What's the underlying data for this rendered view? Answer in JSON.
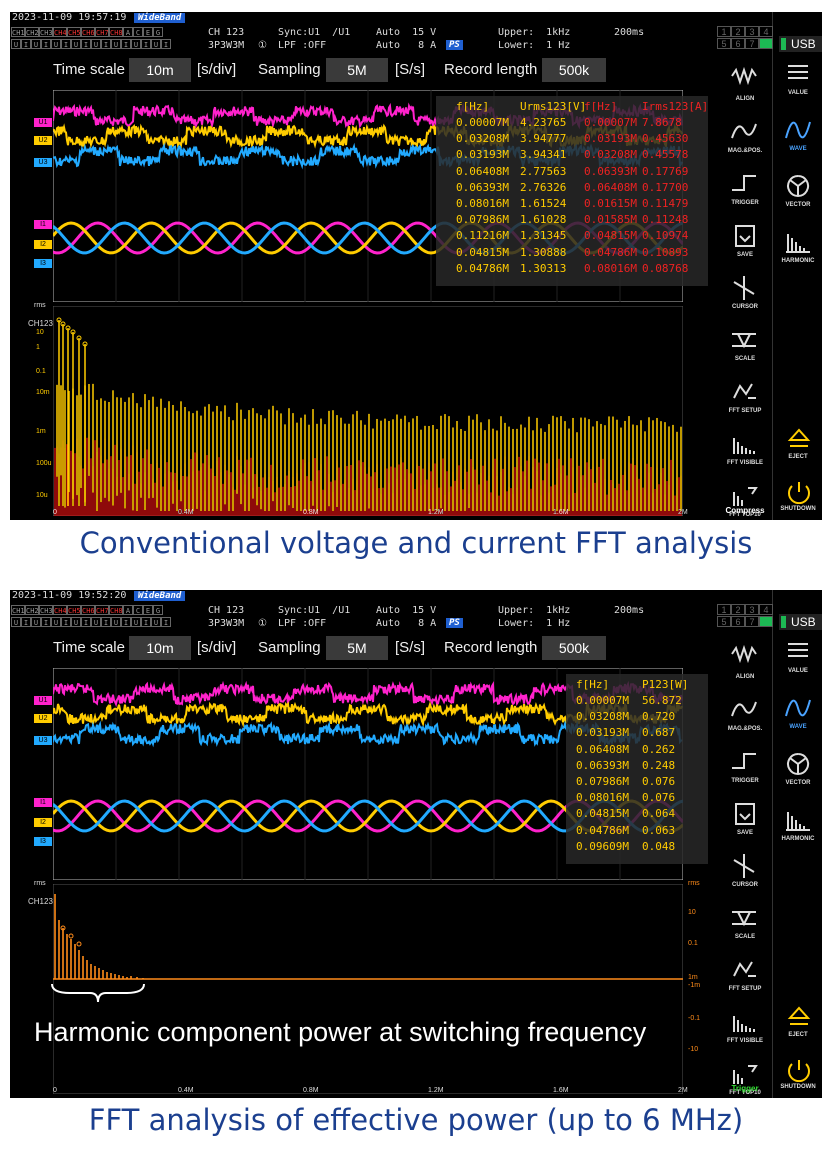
{
  "panels": [
    {
      "status": {
        "datetime": "2023-11-09 19:57:19",
        "mode": "WideBand",
        "channel": "CH 123",
        "wiring": "3P3W3M",
        "circle_one": "①",
        "sync": "Sync:U1  /U1",
        "lpf": "LPF :OFF",
        "range_v": "Auto  15 V",
        "range_a": "Auto   8 A",
        "ps": "PS",
        "upper": "Upper:  1kHz",
        "lower": "Lower:  1 Hz",
        "period": "200ms",
        "ch_row1": [
          "CH1",
          "CH2",
          "CH3",
          "CH4",
          "CH5",
          "CH6",
          "CH7",
          "CH8",
          "A",
          "C",
          "E",
          "G"
        ],
        "ch_row2": [
          "U",
          "I",
          "U",
          "I",
          "U",
          "I",
          "U",
          "I",
          "U",
          "I",
          "U",
          "I",
          "U",
          "I",
          "U",
          "I"
        ]
      },
      "controls": {
        "time_scale_label": "Time scale",
        "time_scale_value": "10m",
        "time_scale_unit": "[s/div]",
        "sampling_label": "Sampling",
        "sampling_value": "5M",
        "sampling_unit": "[S/s]",
        "record_label": "Record length",
        "record_value": "500k"
      },
      "trace_labels": [
        "U1",
        "U2",
        "U3",
        "I1",
        "I2",
        "I3"
      ],
      "table": {
        "headers": [
          "f[Hz]",
          "Urms123[V]",
          "f[Hz]",
          "Irms123[A]"
        ],
        "rows": [
          [
            "0.00007M",
            "4.23765",
            "0.00007M",
            "7.8678"
          ],
          [
            "0.03208M",
            "3.94777",
            "0.03193M",
            "0.45630"
          ],
          [
            "0.03193M",
            "3.94341",
            "0.03208M",
            "0.45578"
          ],
          [
            "0.06408M",
            "2.77563",
            "0.06393M",
            "0.17769"
          ],
          [
            "0.06393M",
            "2.76326",
            "0.06408M",
            "0.17700"
          ],
          [
            "0.08016M",
            "1.61524",
            "0.01615M",
            "0.11479"
          ],
          [
            "0.07986M",
            "1.61028",
            "0.01585M",
            "0.11248"
          ],
          [
            "0.11216M",
            "1.31345",
            "0.04815M",
            "0.10974"
          ],
          [
            "0.04815M",
            "1.30888",
            "0.04786M",
            "0.10893"
          ],
          [
            "0.04786M",
            "1.30313",
            "0.08016M",
            "0.08768"
          ]
        ]
      },
      "fft": {
        "unit": "rms",
        "channel": "CH123",
        "y_ticks": [
          "10",
          "1",
          "0.1",
          "10m",
          "1m",
          "100u",
          "10u"
        ],
        "x_ticks": [
          "0",
          "0.4M",
          "0.8M",
          "1.2M",
          "1.6M",
          "2M"
        ]
      },
      "bottom_button_label": "Compress"
    },
    {
      "status": {
        "datetime": "2023-11-09 19:52:20",
        "mode": "WideBand",
        "channel": "CH 123",
        "wiring": "3P3W3M",
        "circle_one": "①",
        "sync": "Sync:U1  /U1",
        "lpf": "LPF :OFF",
        "range_v": "Auto  15 V",
        "range_a": "Auto   8 A",
        "ps": "PS",
        "upper": "Upper:  1kHz",
        "lower": "Lower:  1 Hz",
        "period": "200ms",
        "ch_row1": [
          "CH1",
          "CH2",
          "CH3",
          "CH4",
          "CH5",
          "CH6",
          "CH7",
          "CH8",
          "A",
          "C",
          "E",
          "G"
        ],
        "ch_row2": [
          "U",
          "I",
          "U",
          "I",
          "U",
          "I",
          "U",
          "I",
          "U",
          "I",
          "U",
          "I",
          "U",
          "I",
          "U",
          "I"
        ]
      },
      "controls": {
        "time_scale_label": "Time scale",
        "time_scale_value": "10m",
        "time_scale_unit": "[s/div]",
        "sampling_label": "Sampling",
        "sampling_value": "5M",
        "sampling_unit": "[S/s]",
        "record_label": "Record length",
        "record_value": "500k"
      },
      "trace_labels": [
        "U1",
        "U2",
        "U3",
        "I1",
        "I2",
        "I3"
      ],
      "table": {
        "headers": [
          "f[Hz]",
          "P123[W]"
        ],
        "rows": [
          [
            "0.00007M",
            "56.872"
          ],
          [
            "0.03208M",
            "0.720"
          ],
          [
            "0.03193M",
            "0.687"
          ],
          [
            "0.06408M",
            "0.262"
          ],
          [
            "0.06393M",
            "0.248"
          ],
          [
            "0.07986M",
            "0.076"
          ],
          [
            "0.08016M",
            "0.076"
          ],
          [
            "0.04815M",
            "0.064"
          ],
          [
            "0.04786M",
            "0.063"
          ],
          [
            "0.09609M",
            "0.048"
          ]
        ]
      },
      "fft": {
        "unit": "rms",
        "unit_right": "rms",
        "channel": "CH123",
        "y_ticks_right": [
          "10",
          "0.1",
          "1m",
          "-1m",
          "-0.1",
          "-10"
        ],
        "x_ticks": [
          "0",
          "0.4M",
          "0.8M",
          "1.2M",
          "1.6M",
          "2M"
        ]
      },
      "overlay": "Harmonic component power at switching frequency",
      "bottom_button_label": "Trigger"
    }
  ],
  "sidebar": [
    "ALIGN",
    "MAG.&POS.",
    "TRIGGER",
    "SAVE",
    "CURSOR",
    "SCALE",
    "FFT SETUP",
    "FFT VISIBLE",
    "FFT TOP10"
  ],
  "rightbar": {
    "usb": "USB",
    "grid": [
      "1",
      "2",
      "3",
      "4",
      "5",
      "6",
      "7",
      "8"
    ],
    "items": [
      "VALUE",
      "WAVE",
      "VECTOR",
      "HARMONIC"
    ],
    "eject": "EJECT",
    "shutdown": "SHUTDOWN"
  },
  "captions": {
    "top": "Conventional voltage and current FFT analysis",
    "bottom": "FFT analysis of effective power (up to 6 MHz)"
  },
  "colors": {
    "u1": "#ff22cc",
    "u2": "#ffcc00",
    "u3": "#22aaff",
    "fft_u": "#ffcc00",
    "fft_i": "#ee1111",
    "power": "#ff8c1a"
  }
}
